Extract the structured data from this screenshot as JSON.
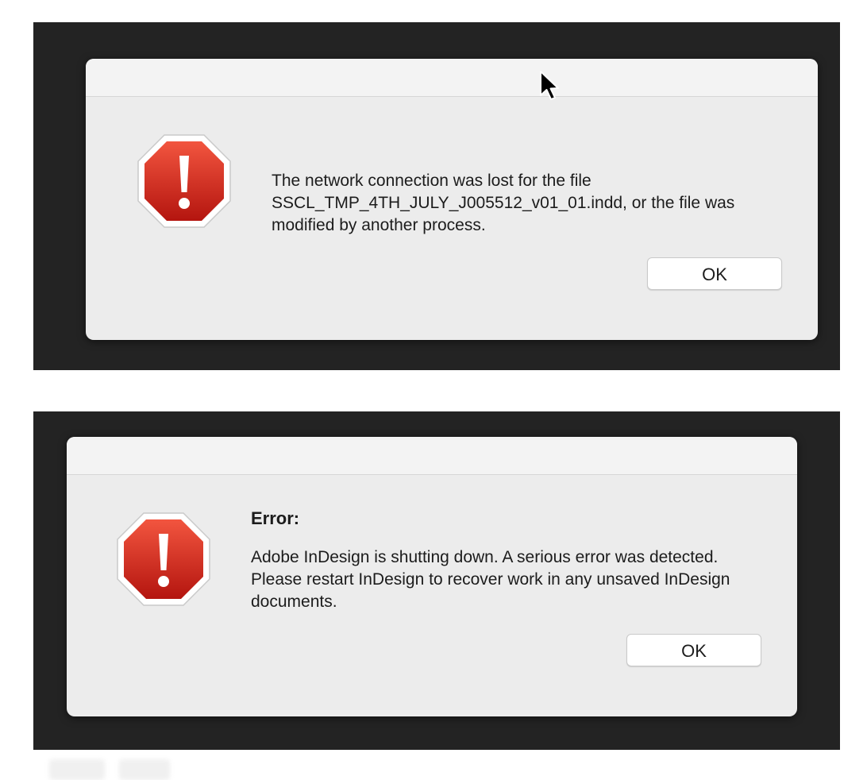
{
  "dialogs": [
    {
      "heading": "",
      "message": "The network connection was lost for the file SSCL_TMP_4TH_JULY_J005512_v01_01.indd, or the file was modified by another process.",
      "button_label": "OK",
      "icon": "stop-alert-icon"
    },
    {
      "heading": "Error:",
      "message": "Adobe InDesign is shutting down. A serious error was detected. Please restart InDesign to recover work in any unsaved InDesign documents.",
      "button_label": "OK",
      "icon": "stop-alert-icon"
    }
  ],
  "colors": {
    "backdrop": "#232323",
    "dialog_bg": "#ececec",
    "icon_red": "#d42a22"
  },
  "cursor_icon": "arrow-cursor-icon"
}
